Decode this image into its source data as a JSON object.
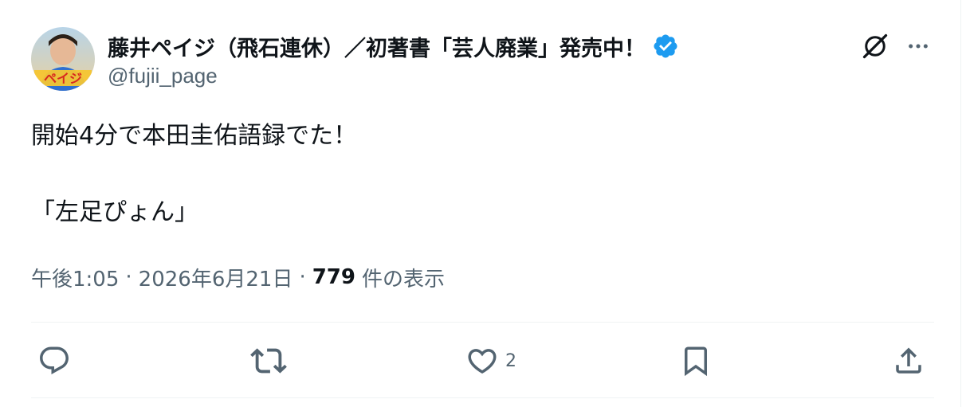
{
  "author": {
    "display_name": "藤井ペイジ（飛石連休）／初著書「芸人廃業」発売中！",
    "handle": "@fujii_page",
    "avatar_text": "ペイジ",
    "verified_icon": "verified-badge-icon",
    "verified_color": "#1d9bf0"
  },
  "header_actions": {
    "grok_icon": "grok-icon",
    "more_icon": "more-horizontal-icon"
  },
  "tweet": {
    "line1": "開始4分で本田圭佑語録でた！",
    "line2": "「左足ぴょん」"
  },
  "meta": {
    "time": "午後1:05",
    "separator": "·",
    "date": "2026年6月21日",
    "views_count": "779",
    "views_label": "件の表示"
  },
  "actions": {
    "reply_icon": "reply-icon",
    "retweet_icon": "retweet-icon",
    "like_icon": "heart-icon",
    "like_count": "2",
    "bookmark_icon": "bookmark-icon",
    "share_icon": "share-icon"
  },
  "colors": {
    "text_primary": "#0f1419",
    "text_secondary": "#536471",
    "divider": "#eff3f4"
  }
}
